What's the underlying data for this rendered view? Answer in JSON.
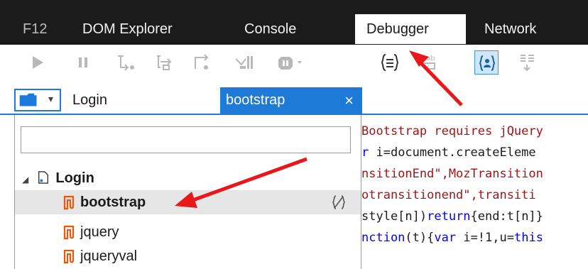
{
  "tabs": {
    "f12": "F12",
    "dom_explorer": "DOM Explorer",
    "console": "Console",
    "debugger": "Debugger",
    "network": "Network"
  },
  "file_tabs": {
    "login": "Login",
    "bootstrap": "bootstrap",
    "close_glyph": "×"
  },
  "file_picker": {
    "search_value": "",
    "root": "Login",
    "items": [
      {
        "label": "bootstrap",
        "selected": true
      },
      {
        "label": "jquery",
        "selected": false
      },
      {
        "label": "jqueryval",
        "selected": false
      }
    ]
  },
  "code_lines": [
    {
      "parts": [
        {
          "t": "Bootstrap requires jQuery",
          "c": "str"
        }
      ]
    },
    {
      "parts": [
        {
          "t": "r",
          "c": "kw"
        },
        {
          "t": " i=document.createEleme",
          "c": ""
        }
      ]
    },
    {
      "parts": [
        {
          "t": "nsitionEnd\",MozTransition",
          "c": "str"
        }
      ]
    },
    {
      "parts": [
        {
          "t": "otransitionend\",transiti",
          "c": "str"
        }
      ]
    },
    {
      "parts": [
        {
          "t": "style[n])",
          "c": ""
        },
        {
          "t": "return",
          "c": "kw"
        },
        {
          "t": "{end:t[n]}",
          "c": ""
        }
      ]
    },
    {
      "parts": [
        {
          "t": "nction",
          "c": "kw"
        },
        {
          "t": "(t){",
          "c": ""
        },
        {
          "t": "var",
          "c": "kw"
        },
        {
          "t": " i=!1,u=",
          "c": ""
        },
        {
          "t": "this",
          "c": "kw"
        }
      ]
    }
  ],
  "colors": {
    "tabbar_bg": "#1b1b1c",
    "accent_blue": "#1d7ad6",
    "file_icon_orange": "#e8590c",
    "annotation_red": "#e8171b"
  },
  "icons": [
    "play-icon",
    "pause-icon",
    "step-into-icon",
    "step-over-icon",
    "step-out-icon",
    "break-on-new-worker-icon",
    "exception-behavior-icon",
    "pretty-print-icon",
    "word-wrap-icon",
    "just-my-code-icon",
    "source-map-icon",
    "folder-icon",
    "script-file-icon",
    "pretty-print-file-icon"
  ]
}
